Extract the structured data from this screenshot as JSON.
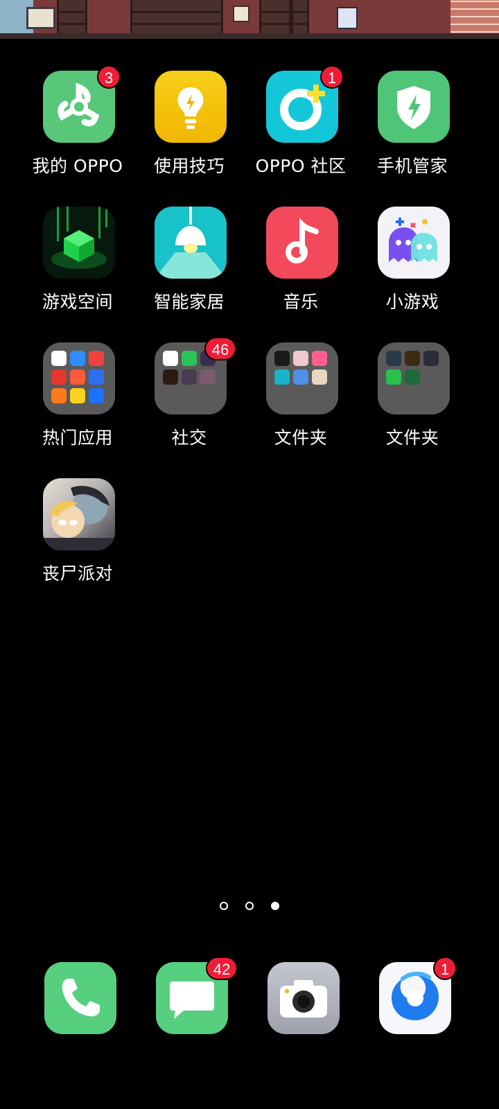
{
  "home": {
    "row1": [
      {
        "label": "我的 OPPO",
        "badge": "3",
        "icon": "pinwheel-icon"
      },
      {
        "label": "使用技巧",
        "badge": "",
        "icon": "lightbulb-icon"
      },
      {
        "label": "OPPO 社区",
        "badge": "1",
        "icon": "ring-plus-icon"
      },
      {
        "label": "手机管家",
        "badge": "",
        "icon": "shield-bolt-icon"
      }
    ],
    "row2": [
      {
        "label": "游戏空间",
        "icon": "green-cube-icon"
      },
      {
        "label": "智能家居",
        "icon": "ceiling-lamp-icon"
      },
      {
        "label": "音乐",
        "icon": "music-note-icon"
      },
      {
        "label": "小游戏",
        "icon": "ghosts-icon"
      }
    ],
    "row3": [
      {
        "label": "热门应用",
        "badge": "",
        "icon": "folder-icon"
      },
      {
        "label": "社交",
        "badge": "46",
        "icon": "folder-icon"
      },
      {
        "label": "文件夹",
        "badge": "",
        "icon": "folder-icon"
      },
      {
        "label": "文件夹",
        "badge": "",
        "icon": "folder-icon"
      }
    ],
    "row4": [
      {
        "label": "丧尸派对",
        "icon": "zombie-party-icon"
      }
    ]
  },
  "dock": [
    {
      "name": "phone",
      "badge": "",
      "icon": "phone-icon"
    },
    {
      "name": "messages",
      "badge": "42",
      "icon": "message-bubble-icon"
    },
    {
      "name": "camera",
      "badge": "",
      "icon": "camera-icon"
    },
    {
      "name": "browser",
      "badge": "1",
      "icon": "browser-icon"
    }
  ],
  "pages": {
    "count": 3,
    "current": 3
  },
  "colors": {
    "badge": "#ee1d36",
    "green": "#58c779",
    "yellow": "#f5c000",
    "cyan": "#14c7d8",
    "music": "#f24a5a",
    "folder": "#5a5a5a"
  }
}
